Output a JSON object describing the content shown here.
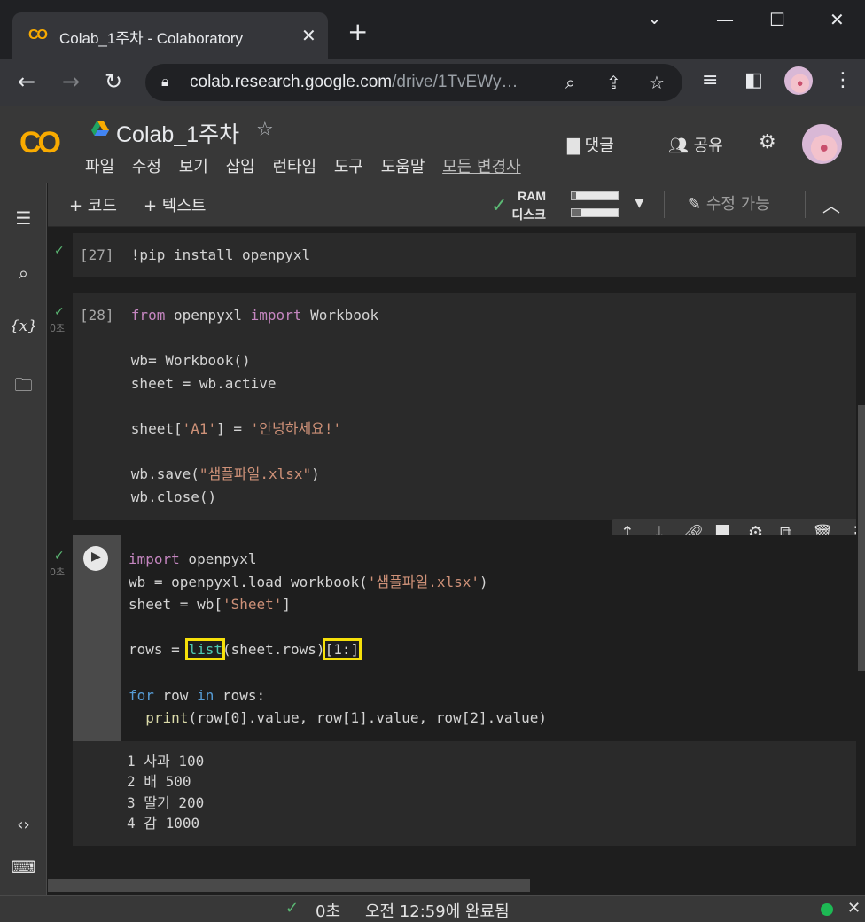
{
  "browser": {
    "tab_title": "Colab_1주차 - Colaboratory",
    "tab_logo": "CO",
    "tab_close": "✕",
    "new_tab": "+",
    "url_host": "colab.research.google.com",
    "url_rest": "/drive/1TvEWy…"
  },
  "colab": {
    "logo": "CO",
    "title": "Colab_1주차",
    "menu": [
      "파일",
      "수정",
      "보기",
      "삽입",
      "런타임",
      "도구",
      "도움말"
    ],
    "all_changes": "모든 변경사",
    "comment_label": "댓글",
    "share_label": "공유"
  },
  "nb_toolbar": {
    "add_code": "+ 코드",
    "add_text": "+ 텍스트",
    "ram_label": "RAM",
    "disk_label": "디스크",
    "ram_fraction": 0.1,
    "disk_fraction": 0.22,
    "edit_mode": "수정 가능"
  },
  "cells": [
    {
      "prompt": "[27]",
      "code": "!pip install openpyxl"
    },
    {
      "prompt": "[28]",
      "exec_time": "0초"
    },
    {
      "exec_time": "0초",
      "outputs": [
        "1 사과 100",
        "2 배 500",
        "3 딸기 200",
        "4 감 1000"
      ]
    }
  ],
  "statusbar": {
    "time": "0초",
    "completed": "오전 12:59에 완료됨"
  },
  "colors": {
    "accent_orange": "#f9ab00",
    "success_green": "#5bb974",
    "highlight_yellow": "#f6e00a"
  }
}
